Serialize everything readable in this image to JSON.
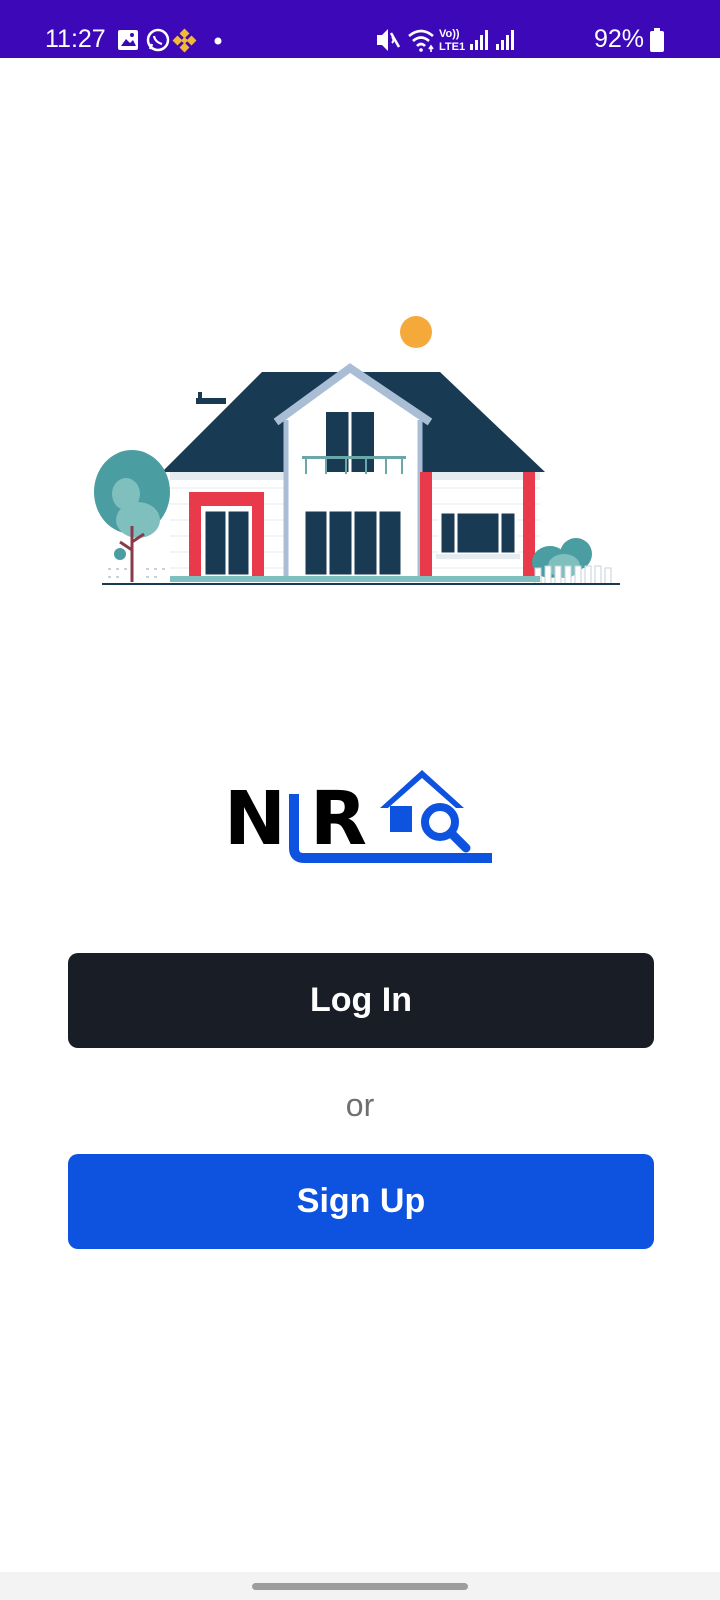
{
  "status_bar": {
    "time": "11:27",
    "battery": "92%",
    "left_icons": [
      "gallery-icon",
      "whatsapp-icon",
      "binance-icon",
      "notification-dot-icon"
    ],
    "right_icons": [
      "mute-icon",
      "wifi-icon",
      "volte-icon",
      "signal-icon",
      "signal-icon",
      "battery-icon"
    ],
    "color": "#3c08b8"
  },
  "logo": {
    "text": "NLR",
    "accent_color": "#0d53e0"
  },
  "actions": {
    "login_label": "Log In",
    "or_label": "or",
    "signup_label": "Sign Up"
  },
  "colors": {
    "login_bg": "#181d26",
    "signup_bg": "#0d53e0"
  }
}
